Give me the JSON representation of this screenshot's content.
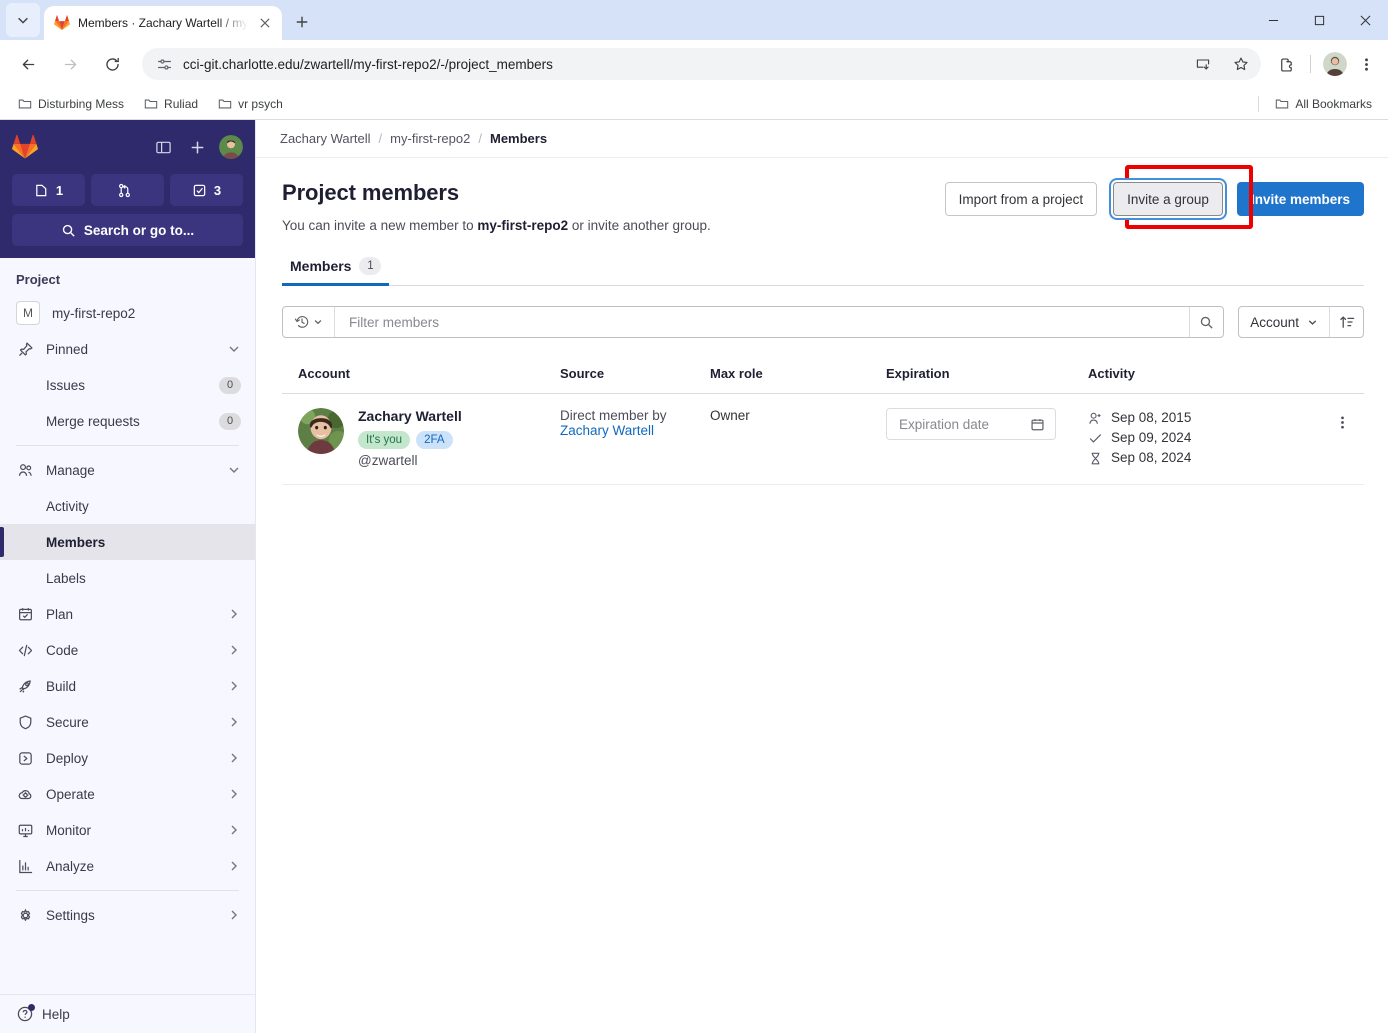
{
  "browser": {
    "tab": {
      "title": "Members · Zachary Wartell / my",
      "favicon": "gitlab-favicon",
      "close_label": "Close tab"
    },
    "new_tab_label": "New tab",
    "window": {
      "minimize": "Minimize",
      "maximize": "Maximize",
      "close": "Close"
    },
    "toolbar": {
      "back": "Back",
      "forward": "Forward",
      "reload": "Reload",
      "site_info": "View site information",
      "url": "cci-git.charlotte.edu/zwartell/my-first-repo2/-/project_members",
      "install": "Install app",
      "bookmark": "Bookmark this tab",
      "extensions": "Extensions",
      "profile": "Profile",
      "menu": "Customize and control Chrome"
    },
    "bookmarks": {
      "items": [
        {
          "label": "Disturbing Mess"
        },
        {
          "label": "Ruliad"
        },
        {
          "label": "vr psych"
        }
      ],
      "all_bookmarks": "All Bookmarks"
    }
  },
  "sidebar": {
    "brand": "GitLab",
    "toggle_label": "Collapse sidebar",
    "create_label": "Create new",
    "counters": [
      {
        "name": "issues",
        "value": "1"
      },
      {
        "name": "merge-requests",
        "value": ""
      },
      {
        "name": "todos",
        "value": "3"
      }
    ],
    "search_placeholder": "Search or go to...",
    "section_title": "Project",
    "project": {
      "initial": "M",
      "name": "my-first-repo2"
    },
    "items": [
      {
        "label": "Pinned",
        "icon": "pin-icon",
        "expandable": true
      },
      {
        "label": "Issues",
        "icon": "",
        "count": "0",
        "sub": true
      },
      {
        "label": "Merge requests",
        "icon": "",
        "count": "0",
        "sub": true
      },
      {
        "label": "Manage",
        "icon": "users-icon",
        "expandable": true
      },
      {
        "label": "Activity",
        "icon": "",
        "sub": true
      },
      {
        "label": "Members",
        "icon": "",
        "sub": true,
        "active": true
      },
      {
        "label": "Labels",
        "icon": "",
        "sub": true
      },
      {
        "label": "Plan",
        "icon": "calendar-icon",
        "expandable": true
      },
      {
        "label": "Code",
        "icon": "code-icon",
        "expandable": true
      },
      {
        "label": "Build",
        "icon": "rocket-icon",
        "expandable": true
      },
      {
        "label": "Secure",
        "icon": "shield-icon",
        "expandable": true
      },
      {
        "label": "Deploy",
        "icon": "deploy-icon",
        "expandable": true
      },
      {
        "label": "Operate",
        "icon": "cloud-gear-icon",
        "expandable": true
      },
      {
        "label": "Monitor",
        "icon": "monitor-icon",
        "expandable": true
      },
      {
        "label": "Analyze",
        "icon": "chart-icon",
        "expandable": true
      },
      {
        "label": "Settings",
        "icon": "gear-icon",
        "expandable": true
      }
    ],
    "help": "Help"
  },
  "breadcrumb": {
    "items": [
      "Zachary Wartell",
      "my-first-repo2",
      "Members"
    ],
    "separator": "/"
  },
  "page": {
    "title": "Project members",
    "subtitle_prefix": "You can invite a new member to ",
    "subtitle_project": "my-first-repo2",
    "subtitle_suffix": " or invite another group.",
    "actions": {
      "import": "Import from a project",
      "invite_group": "Invite a group",
      "invite_members": "Invite members"
    },
    "highlight_color": "#ee0000"
  },
  "tabs": [
    {
      "label": "Members",
      "count": "1",
      "active": true
    }
  ],
  "filter": {
    "history_label": "Recent searches",
    "placeholder": "Filter members",
    "search_label": "Search",
    "sort_field": "Account",
    "sort_direction": "ascending"
  },
  "table": {
    "columns": [
      "Account",
      "Source",
      "Max role",
      "Expiration",
      "Activity",
      ""
    ],
    "rows": [
      {
        "account": {
          "name": "Zachary Wartell",
          "badges": [
            {
              "label": "It's you",
              "type": "you"
            },
            {
              "label": "2FA",
              "type": "2fa"
            }
          ],
          "handle": "@zwartell"
        },
        "source_text": "Direct member by",
        "source_link": "Zachary Wartell",
        "max_role": "Owner",
        "expiration_placeholder": "Expiration date",
        "activity": [
          {
            "icon": "user-plus-icon",
            "date": "Sep 08, 2015"
          },
          {
            "icon": "check-icon",
            "date": "Sep 09, 2024"
          },
          {
            "icon": "hourglass-icon",
            "date": "Sep 08, 2024"
          }
        ],
        "menu_label": "Member actions"
      }
    ]
  }
}
